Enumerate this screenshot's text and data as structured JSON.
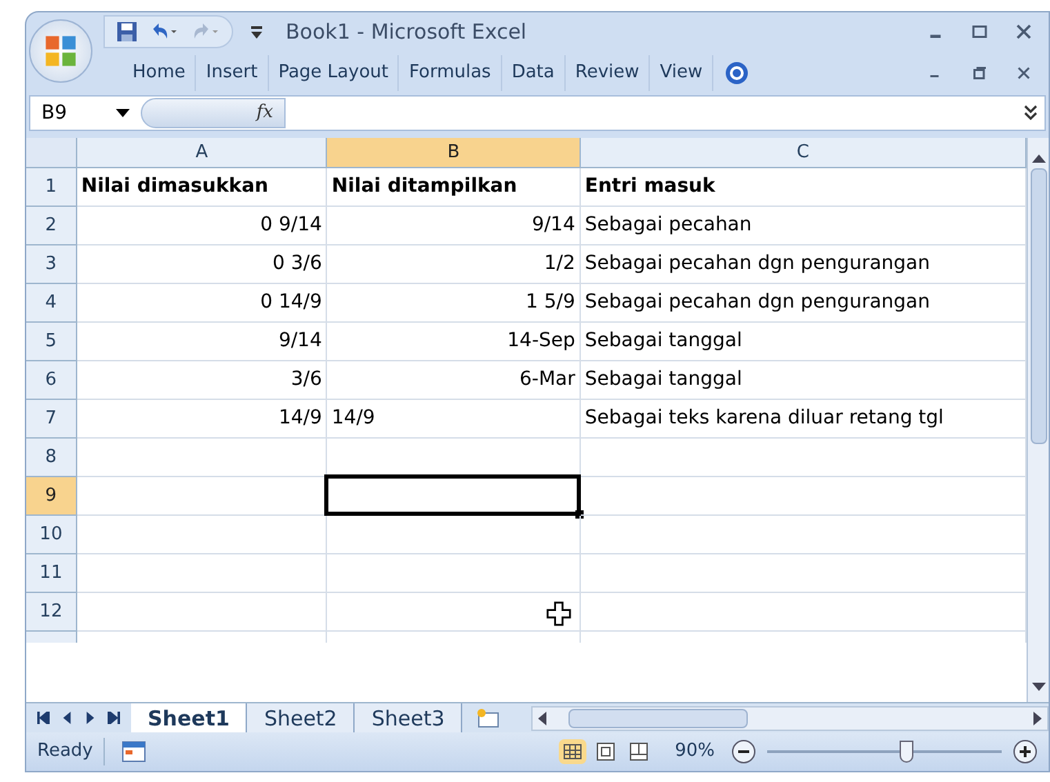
{
  "window": {
    "title": "Book1 - Microsoft Excel"
  },
  "ribbon_tabs": [
    {
      "label": "Home",
      "selected": false
    },
    {
      "label": "Insert",
      "selected": false
    },
    {
      "label": "Page Layout",
      "selected": false
    },
    {
      "label": "Formulas",
      "selected": false
    },
    {
      "label": "Data",
      "selected": false
    },
    {
      "label": "Review",
      "selected": false
    },
    {
      "label": "View",
      "selected": false
    }
  ],
  "formula_bar": {
    "name_box": "B9",
    "fx": "fx"
  },
  "columns": [
    {
      "label": "A",
      "selected": false
    },
    {
      "label": "B",
      "selected": true
    },
    {
      "label": "C",
      "selected": false
    }
  ],
  "rows": [
    {
      "number": "1",
      "selected": false,
      "bold": true,
      "cells": [
        {
          "text": "Nilai dimasukkan",
          "kind": "text"
        },
        {
          "text": "Nilai ditampilkan",
          "kind": "text"
        },
        {
          "text": "Entri masuk",
          "kind": "text"
        }
      ]
    },
    {
      "number": "2",
      "selected": false,
      "bold": false,
      "cells": [
        {
          "text": "0 9/14",
          "kind": "number"
        },
        {
          "text": "9/14",
          "kind": "number"
        },
        {
          "text": "Sebagai pecahan",
          "kind": "text"
        }
      ]
    },
    {
      "number": "3",
      "selected": false,
      "bold": false,
      "cells": [
        {
          "text": "0 3/6",
          "kind": "number"
        },
        {
          "text": "1/2",
          "kind": "number"
        },
        {
          "text": "Sebagai pecahan dgn pengurangan",
          "kind": "text"
        }
      ]
    },
    {
      "number": "4",
      "selected": false,
      "bold": false,
      "cells": [
        {
          "text": "0 14/9",
          "kind": "number"
        },
        {
          "text": "1 5/9",
          "kind": "number"
        },
        {
          "text": "Sebagai pecahan dgn pengurangan",
          "kind": "text"
        }
      ]
    },
    {
      "number": "5",
      "selected": false,
      "bold": false,
      "cells": [
        {
          "text": "9/14",
          "kind": "number"
        },
        {
          "text": "14-Sep",
          "kind": "number"
        },
        {
          "text": "Sebagai tanggal",
          "kind": "text"
        }
      ]
    },
    {
      "number": "6",
      "selected": false,
      "bold": false,
      "cells": [
        {
          "text": "3/6",
          "kind": "number"
        },
        {
          "text": "6-Mar",
          "kind": "number"
        },
        {
          "text": "Sebagai tanggal",
          "kind": "text"
        }
      ]
    },
    {
      "number": "7",
      "selected": false,
      "bold": false,
      "cells": [
        {
          "text": "14/9",
          "kind": "number"
        },
        {
          "text": "14/9",
          "kind": "text"
        },
        {
          "text": "Sebagai teks karena diluar retang tgl",
          "kind": "text"
        }
      ]
    },
    {
      "number": "8",
      "selected": false,
      "bold": false
    },
    {
      "number": "9",
      "selected": true,
      "bold": false
    },
    {
      "number": "10",
      "selected": false,
      "bold": false
    },
    {
      "number": "11",
      "selected": false,
      "bold": false
    },
    {
      "number": "12",
      "selected": false,
      "bold": false
    }
  ],
  "sheet_tabs": [
    {
      "label": "Sheet1",
      "selected": true
    },
    {
      "label": "Sheet2",
      "selected": false
    },
    {
      "label": "Sheet3",
      "selected": false
    }
  ],
  "status_bar": {
    "status": "Ready",
    "zoom": "90%",
    "zoom_level": {
      "level": 0.6
    }
  }
}
